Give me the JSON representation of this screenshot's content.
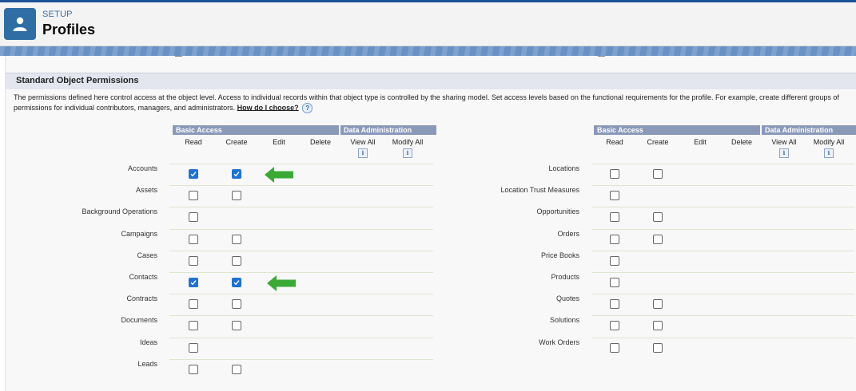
{
  "header": {
    "breadcrumb": "SETUP",
    "title": "Profiles",
    "icon": "user-icon",
    "icon_color": "#2f6ea5"
  },
  "section": {
    "title": "Standard Object Permissions",
    "description": "The permissions defined here control access at the object level. Access to individual records within that object type is controlled by the sharing model. Set access levels based on the functional requirements for the profile. For example, create different groups of permissions for individual contributors, managers, and administrators.",
    "help_link": "How do I choose?",
    "help_icon": "?"
  },
  "table": {
    "group_basic": "Basic Access",
    "group_admin": "Data Administration",
    "columns": [
      "Read",
      "Create",
      "Edit",
      "Delete",
      "View All",
      "Modify All"
    ],
    "info_icon": "i"
  },
  "left_rows": [
    {
      "label": "Accounts",
      "read": true,
      "create": true
    },
    {
      "label": "Assets",
      "read": false,
      "create": false
    },
    {
      "label": "Background Operations",
      "read": false,
      "create": null
    },
    {
      "label": "Campaigns",
      "read": false,
      "create": false
    },
    {
      "label": "Cases",
      "read": false,
      "create": false
    },
    {
      "label": "Contacts",
      "read": true,
      "create": true
    },
    {
      "label": "Contracts",
      "read": false,
      "create": false
    },
    {
      "label": "Documents",
      "read": false,
      "create": false
    },
    {
      "label": "Ideas",
      "read": false,
      "create": null
    },
    {
      "label": "Leads",
      "read": false,
      "create": false
    }
  ],
  "right_rows": [
    {
      "label": "Locations",
      "read": false,
      "create": false
    },
    {
      "label": "Location Trust Measures",
      "read": false,
      "create": null
    },
    {
      "label": "Opportunities",
      "read": false,
      "create": false
    },
    {
      "label": "Orders",
      "read": false,
      "create": false
    },
    {
      "label": "Price Books",
      "read": false,
      "create": null
    },
    {
      "label": "Products",
      "read": false,
      "create": null
    },
    {
      "label": "Quotes",
      "read": false,
      "create": false
    },
    {
      "label": "Solutions",
      "read": false,
      "create": false
    },
    {
      "label": "Work Orders",
      "read": false,
      "create": false
    }
  ],
  "annotations": [
    {
      "icon": "green-arrow-icon",
      "points_to": "Accounts",
      "color": "#3aaa35"
    },
    {
      "icon": "green-arrow-icon",
      "points_to": "Contacts",
      "color": "#3aaa35"
    }
  ],
  "colors": {
    "group_header": "#8b99b9",
    "checkbox_checked": "#1f71d6",
    "row_divider": "#dce6cc"
  }
}
